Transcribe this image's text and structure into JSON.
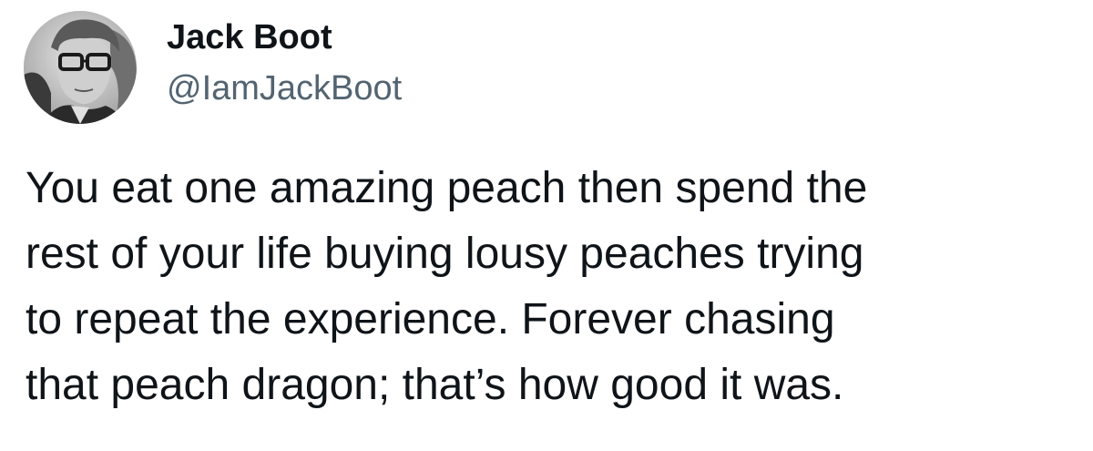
{
  "author": {
    "display_name": "Jack Boot",
    "handle": "@IamJackBoot",
    "avatar_icon": "profile-photo"
  },
  "tweet": {
    "lines": [
      "You eat one amazing peach then spend the",
      "rest of your life buying lousy peaches trying",
      "to repeat the experience. Forever chasing",
      "that peach dragon; that’s how good it was."
    ]
  },
  "colors": {
    "text": "#0f1419",
    "handle": "#536471",
    "background": "#ffffff"
  }
}
